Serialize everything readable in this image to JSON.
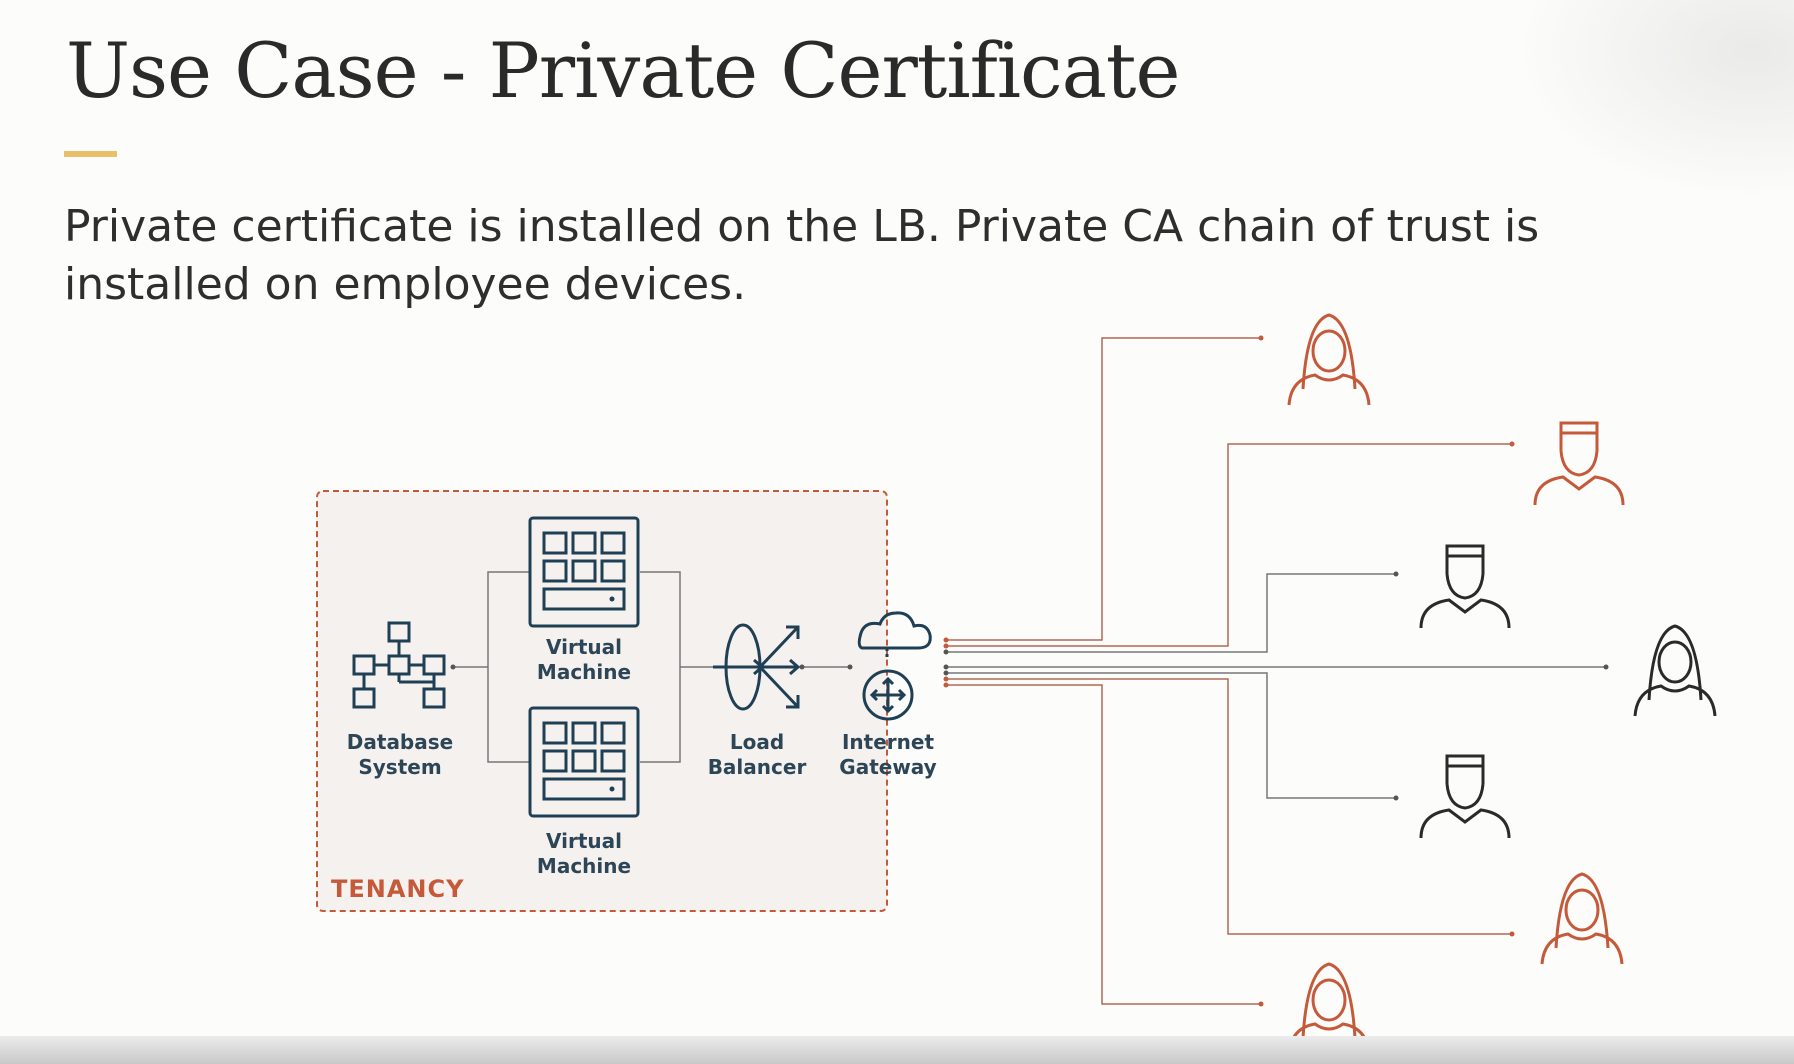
{
  "slide": {
    "title": "Use Case - Private Certificate",
    "body": "Private certificate is installed on the LB. Private CA chain of trust is installed on employee devices."
  },
  "diagram": {
    "tenancy_label": "TENANCY",
    "nodes": {
      "database": [
        "Database",
        "System"
      ],
      "vm_top": [
        "Virtual",
        "Machine"
      ],
      "vm_bottom": [
        "Virtual",
        "Machine"
      ],
      "load_balancer": [
        "Load",
        "Balancer"
      ],
      "internet_gateway": [
        "Internet",
        "Gateway"
      ]
    },
    "users": [
      {
        "type": "female",
        "color": "#c55a3a"
      },
      {
        "type": "male",
        "color": "#c55a3a"
      },
      {
        "type": "male",
        "color": "#2a2a2a"
      },
      {
        "type": "female",
        "color": "#2a2a2a"
      },
      {
        "type": "male",
        "color": "#2a2a2a"
      },
      {
        "type": "female",
        "color": "#c55a3a"
      },
      {
        "type": "female",
        "color": "#c55a3a"
      }
    ],
    "colors": {
      "accent_orange": "#c55a3a",
      "icon_navy": "#1f3f55",
      "title_bar": "#e8c06a",
      "tenancy_fill": "#f5f1ee"
    }
  }
}
